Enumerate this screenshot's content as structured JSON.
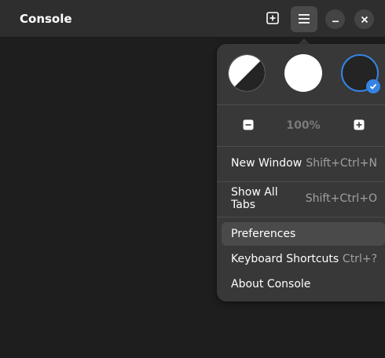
{
  "window": {
    "title": "Console"
  },
  "headerbar": {
    "new_tab_icon": "tab-new-icon",
    "menu_icon": "open-menu-icon",
    "minimize_icon": "window-minimize-icon",
    "close_icon": "window-close-icon"
  },
  "menu": {
    "styles": [
      {
        "name": "follow-system",
        "selected": false
      },
      {
        "name": "light",
        "selected": false
      },
      {
        "name": "dark",
        "selected": true
      }
    ],
    "zoom": {
      "out_icon": "zoom-out-icon",
      "level": "100%",
      "in_icon": "zoom-in-icon"
    },
    "sections": [
      [
        {
          "label": "New Window",
          "accel": "Shift+Ctrl+N"
        }
      ],
      [
        {
          "label": "Show All Tabs",
          "accel": "Shift+Ctrl+O"
        }
      ],
      [
        {
          "label": "Preferences",
          "accel": ""
        },
        {
          "label": "Keyboard Shortcuts",
          "accel": "Ctrl+?"
        },
        {
          "label": "About Console",
          "accel": ""
        }
      ]
    ]
  },
  "colors": {
    "accent": "#3584e4",
    "headerbar": "#2e2e2e",
    "popover": "#383838",
    "terminal_bg": "#1e1e1e"
  }
}
